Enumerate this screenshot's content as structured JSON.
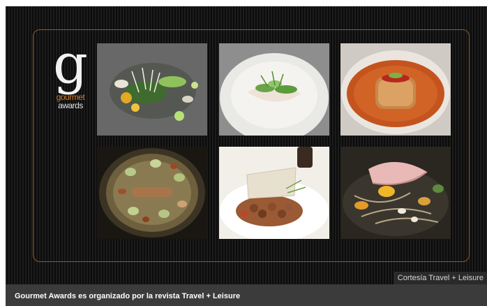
{
  "logo": {
    "letter": "g",
    "word1": "gourmet",
    "word2": "awards"
  },
  "gallery": {
    "photos": [
      {
        "name": "dish-photo-1",
        "icon": "dish-image"
      },
      {
        "name": "dish-photo-2",
        "icon": "dish-image"
      },
      {
        "name": "dish-photo-3",
        "icon": "dish-image"
      },
      {
        "name": "dish-photo-4",
        "icon": "dish-image"
      },
      {
        "name": "dish-photo-5",
        "icon": "dish-image"
      },
      {
        "name": "dish-photo-6",
        "icon": "dish-image"
      }
    ]
  },
  "credit": "Cortesía Travel + Leisure",
  "caption": "Gourmet Awards es organizado por la revista Travel + Leisure",
  "colors": {
    "frame": "#161616",
    "accent_border": "#8a5a2a",
    "logo_accent": "#c9782d",
    "caption_bar": "#3b3b3b"
  }
}
